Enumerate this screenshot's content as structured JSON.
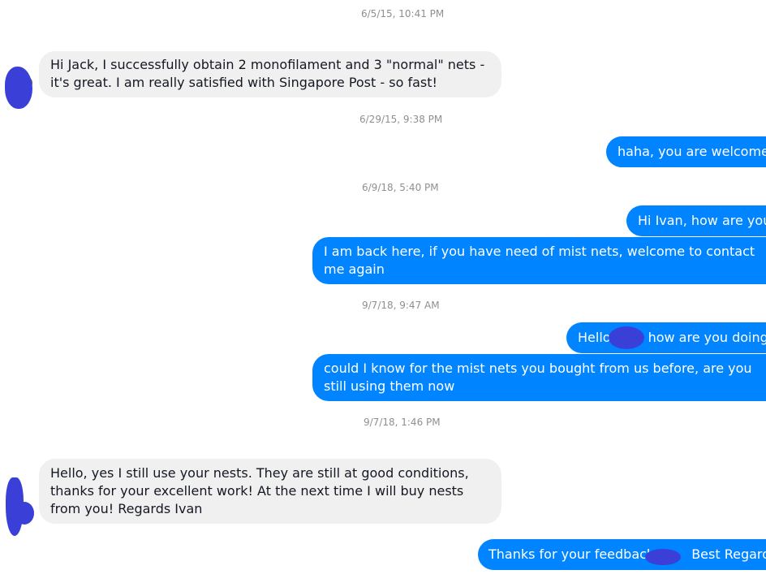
{
  "messages": {
    "ts1": "6/5/15, 10:41 PM",
    "in1": "Hi Jack, I successfully obtain 2 monofilament and 3 \"normal\" nets - it's great. I am really satisfied with Singapore Post - so fast!",
    "ts2": "6/29/15, 9:38 PM",
    "out1": "haha, you are welcome!",
    "ts3": "6/9/18, 5:40 PM",
    "out2": "Hi Ivan, how are you",
    "out3": "I am back here, if you have need of mist nets, welcome to contact me again",
    "ts4": "9/7/18, 9:47 AM",
    "out4_a": "Hello",
    "out4_b": "how are you doing",
    "out5": "could I know for the mist nets you bought from us before, are you still using them now",
    "ts5": "9/7/18, 1:46 PM",
    "in2": "Hello, yes I still use your nests. They are still at good conditions, thanks for your excellent work! At the next time I will buy nests from you! Regards Ivan",
    "out6_a": "Thanks for your feedback",
    "out6_b": "Best Regards"
  },
  "colors": {
    "outgoing": "#0084ff",
    "incoming": "#f1f0f0",
    "redaction": "#3a3fd8"
  }
}
